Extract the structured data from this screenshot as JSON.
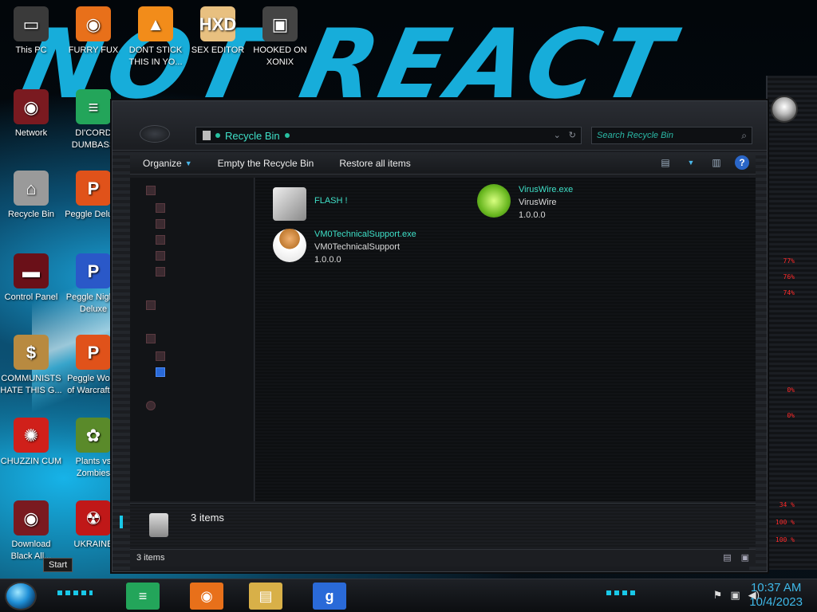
{
  "wallpaper": {
    "text": "NOT REACT"
  },
  "desktop_icons": [
    {
      "label": "This PC",
      "color": "#3a3a3a",
      "glyph": "▭"
    },
    {
      "label": "FURRY FUX",
      "color": "#e8701a",
      "glyph": "◉"
    },
    {
      "label": "DONT STICK THIS IN YO...",
      "color": "#f28c1a",
      "glyph": "▲"
    },
    {
      "label": "SEX EDITOR",
      "color": "#e8c080",
      "glyph": "HXD"
    },
    {
      "label": "HOOKED ON XONIX",
      "color": "#444444",
      "glyph": "▣"
    },
    {
      "label": "Network",
      "color": "#7a1a20",
      "glyph": "◉"
    },
    {
      "label": "DI'CORD DUMBASS",
      "color": "#23a55a",
      "glyph": "≡"
    },
    {
      "label": "Recycle Bin",
      "color": "#9a9a9a",
      "glyph": "⌂"
    },
    {
      "label": "Peggle Deluxe",
      "color": "#e0521a",
      "glyph": "P"
    },
    {
      "label": "Control Panel",
      "color": "#6a1018",
      "glyph": "▬"
    },
    {
      "label": "Peggle Nights Deluxe",
      "color": "#2a58c8",
      "glyph": "P"
    },
    {
      "label": "COMMUNISTS HATE THIS G...",
      "color": "#b88a40",
      "glyph": "$"
    },
    {
      "label": "Peggle World of Warcraft ...",
      "color": "#e0521a",
      "glyph": "P"
    },
    {
      "label": "CHUZZIN CUM",
      "color": "#d0201a",
      "glyph": "✺"
    },
    {
      "label": "Plants vs Zombies",
      "color": "#5a8a2a",
      "glyph": "✿"
    },
    {
      "label": "Download Black All...",
      "color": "#7a1a20",
      "glyph": "◉"
    },
    {
      "label": "UKRAINE",
      "color": "#c01818",
      "glyph": "☢"
    }
  ],
  "window": {
    "address": "Recycle Bin",
    "search_placeholder": "Search Recycle Bin",
    "toolbar": {
      "organize": "Organize",
      "empty": "Empty the Recycle Bin",
      "restore": "Restore all items"
    },
    "files": [
      {
        "name": "FLASH !",
        "type": "",
        "version": "",
        "icon_color": "#d0d0d0"
      },
      {
        "name": "VirusWire.exe",
        "type": "VirusWire",
        "version": "1.0.0.0",
        "icon_color": "#7ed321"
      },
      {
        "name": "VM0TechnicalSupport.exe",
        "type": "VM0TechnicalSupport",
        "version": "1.0.0.0",
        "icon_color": "#e8a060"
      }
    ],
    "details_count": "3 items",
    "status_count": "3 items"
  },
  "side_stats": [
    "77%",
    "76%",
    "74%",
    "0%",
    "0%",
    "34 %",
    "100 %",
    "100 %"
  ],
  "taskbar": {
    "start_tip": "Start",
    "apps": [
      {
        "name": "discord",
        "color": "#23a55a",
        "glyph": "≡"
      },
      {
        "name": "firefox",
        "color": "#e8701a",
        "glyph": "◉"
      },
      {
        "name": "file-explorer",
        "color": "#d8b048",
        "glyph": "▤"
      },
      {
        "name": "gmod",
        "color": "#2a6ad8",
        "glyph": "g"
      }
    ],
    "time": "10:37 AM",
    "date": "10/4/2023"
  }
}
